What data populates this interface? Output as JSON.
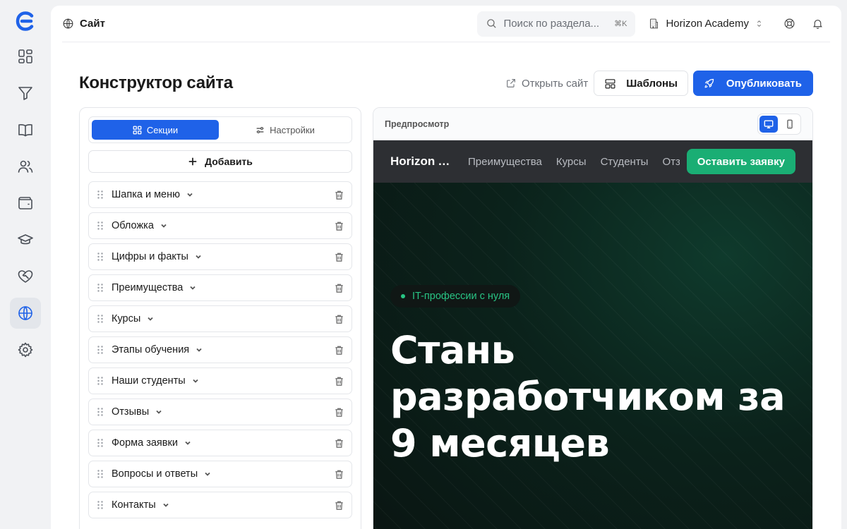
{
  "nav": {
    "items": [
      {
        "icon": "dashboard-icon"
      },
      {
        "icon": "funnel-icon"
      },
      {
        "icon": "book-icon"
      },
      {
        "icon": "users-icon"
      },
      {
        "icon": "wallet-icon"
      },
      {
        "icon": "graduation-cap-icon"
      },
      {
        "icon": "heart-handshake-icon"
      },
      {
        "icon": "globe-icon",
        "active": true
      },
      {
        "icon": "gear-icon"
      }
    ]
  },
  "topbar": {
    "crumb": "Сайт",
    "search_placeholder": "Поиск по раздела...",
    "search_shortcut": "⌘K",
    "org_name": "Horizon Academy"
  },
  "header": {
    "title": "Конструктор сайта",
    "open_site": "Открыть сайт",
    "templates": "Шаблоны",
    "publish": "Опубликовать"
  },
  "sections_panel": {
    "tab_sections": "Секции",
    "tab_settings": "Настройки",
    "add": "Добавить",
    "items": [
      "Шапка и меню",
      "Обложка",
      "Цифры и факты",
      "Преимущества",
      "Курсы",
      "Этапы обучения",
      "Наши студенты",
      "Отзывы",
      "Форма заявки",
      "Вопросы и ответы",
      "Контакты"
    ]
  },
  "preview": {
    "label": "Предпросмотр",
    "site": {
      "brand": "Horizon Ac...",
      "links": [
        "Преимущества",
        "Курсы",
        "Студенты",
        "Отзы"
      ],
      "cta": "Оставить заявку",
      "pill": "IT-профессии с нуля",
      "headline": "Стань разработчиком за 9 месяцев"
    }
  },
  "colors": {
    "accent": "#1f62e8",
    "site_cta": "#1aae74",
    "site_nav": "#2d2f33",
    "hero_bg": "#0b221b"
  }
}
